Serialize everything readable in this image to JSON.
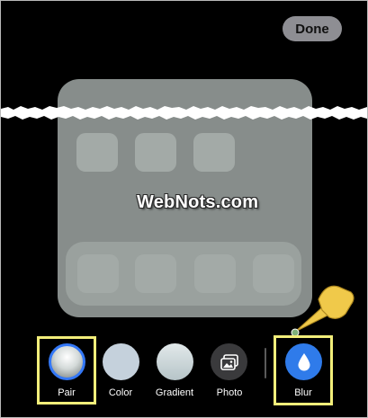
{
  "header": {
    "done_label": "Done"
  },
  "preview": {
    "watermark": "WebNots.com",
    "top_row_icons": 3,
    "dock_icons": 4
  },
  "toolbar": {
    "options": [
      {
        "label": "Pair",
        "icon": "pair-swatch-icon",
        "selected": true,
        "highlighted": true
      },
      {
        "label": "Color",
        "icon": "color-swatch-icon",
        "selected": false,
        "highlighted": false
      },
      {
        "label": "Gradient",
        "icon": "gradient-swatch-icon",
        "selected": false,
        "highlighted": false
      },
      {
        "label": "Photo",
        "icon": "photo-icon",
        "selected": false,
        "highlighted": false
      },
      {
        "label": "Blur",
        "icon": "water-drop-icon",
        "selected": false,
        "highlighted": true
      }
    ]
  },
  "colors": {
    "background": "#000000",
    "highlight_box": "#f2ee7a",
    "pointer": "#f0c94a",
    "blur_accent": "#2f7bea",
    "selected_ring": "#3478f6"
  }
}
